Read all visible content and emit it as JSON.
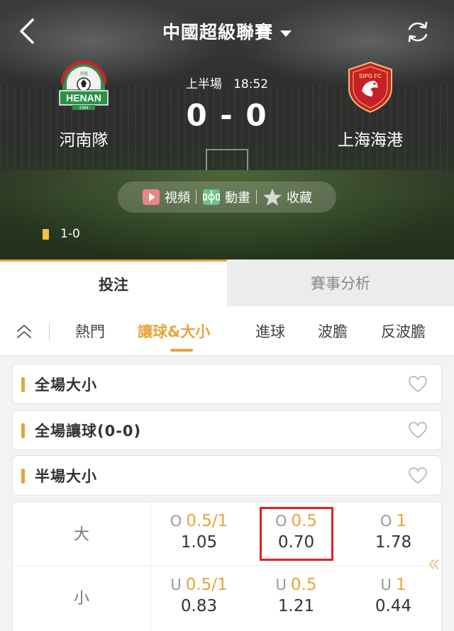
{
  "header": {
    "league": "中國超級聯賽",
    "period": "上半場",
    "time": "18:52",
    "score": "0 - 0",
    "home_team": {
      "name": "河南隊",
      "logo_text": "HENAN",
      "logo_sub": "河南",
      "logo_year": "1994"
    },
    "away_team": {
      "name": "上海海港",
      "logo_text": "SIPG FC"
    },
    "media": {
      "video": "視頻",
      "animation": "動畫",
      "favorite": "收藏"
    },
    "cards": {
      "value": "1-0"
    }
  },
  "main_tabs": [
    {
      "label": "投注",
      "active": true
    },
    {
      "label": "賽事分析",
      "active": false
    }
  ],
  "sub_tabs": [
    {
      "label": "熱門",
      "active": false
    },
    {
      "label": "讓球&大小",
      "active": true
    },
    {
      "label": "進球",
      "active": false
    },
    {
      "label": "波膽",
      "active": false
    },
    {
      "label": "反波膽",
      "active": false
    }
  ],
  "markets": [
    {
      "label": "全場大小"
    },
    {
      "label": "全場讓球(0-0)"
    },
    {
      "label": "半場大小"
    }
  ],
  "odds": {
    "rows": [
      {
        "label": "大",
        "cells": [
          {
            "prefix": "O",
            "line": "0.5/1",
            "odd": "1.05"
          },
          {
            "prefix": "O",
            "line": "0.5",
            "odd": "0.70",
            "selected": true
          },
          {
            "prefix": "O",
            "line": "1",
            "odd": "1.78"
          }
        ]
      },
      {
        "label": "小",
        "cells": [
          {
            "prefix": "U",
            "line": "0.5/1",
            "odd": "0.83"
          },
          {
            "prefix": "U",
            "line": "0.5",
            "odd": "1.21"
          },
          {
            "prefix": "U",
            "line": "1",
            "odd": "0.44"
          }
        ]
      }
    ]
  },
  "colors": {
    "accent": "#e6a53a",
    "highlight": "#e02020",
    "yellow_card": "#f2c33c"
  }
}
